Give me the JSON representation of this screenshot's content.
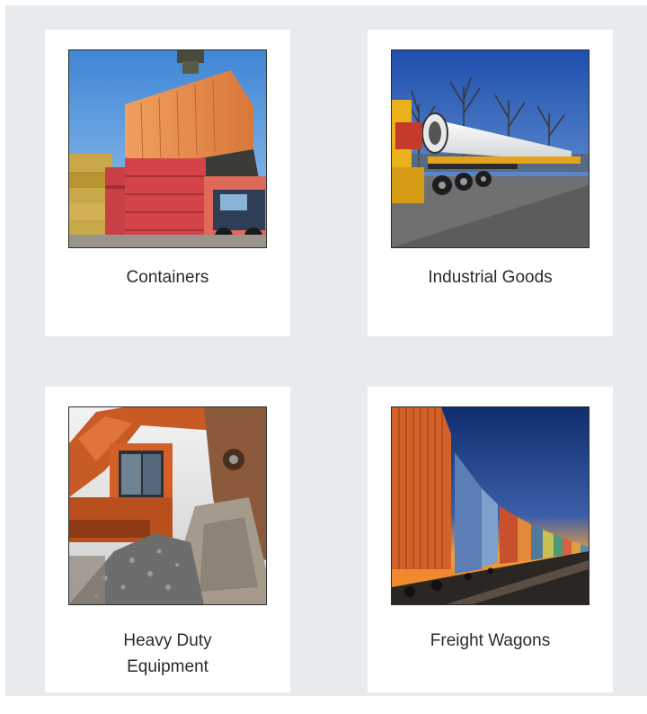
{
  "products": [
    {
      "label": "Containers",
      "image": "containers-photo"
    },
    {
      "label": "Industrial Goods",
      "image": "industrial-goods-photo"
    },
    {
      "label": "Heavy Duty\nEquipment",
      "image": "heavy-duty-equipment-photo"
    },
    {
      "label": "Freight Wagons",
      "image": "freight-wagons-photo"
    }
  ]
}
